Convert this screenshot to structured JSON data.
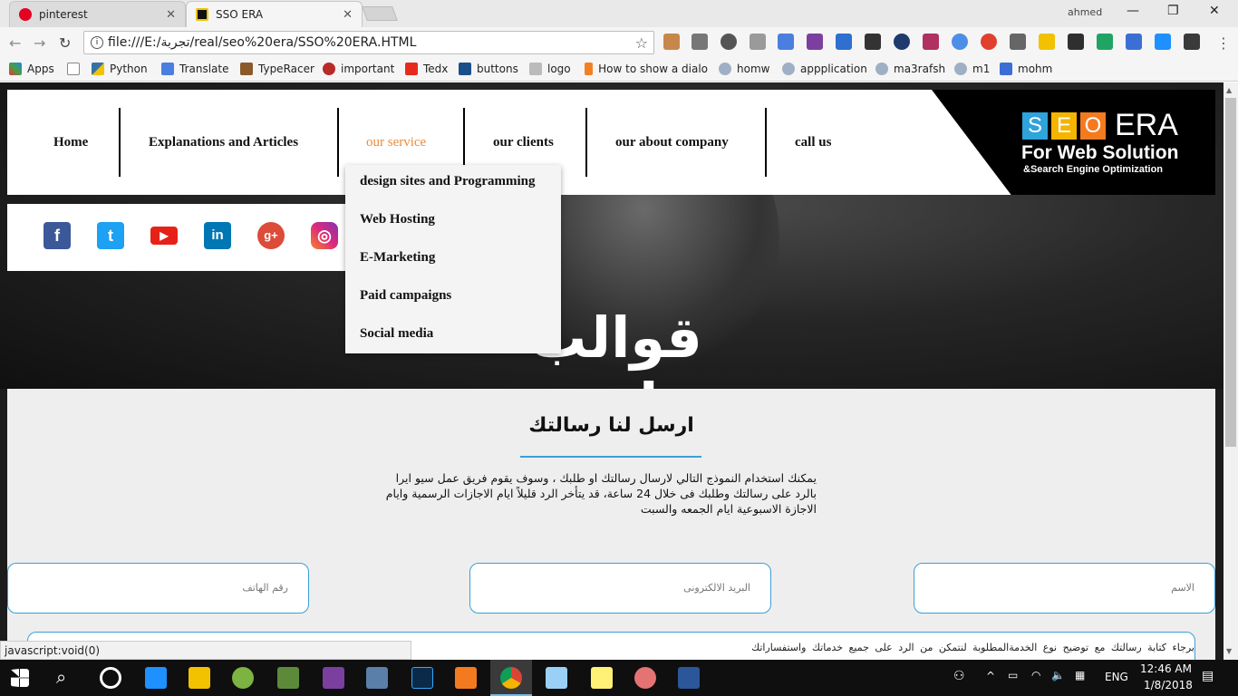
{
  "browser": {
    "tabs": [
      {
        "label": "pinterest",
        "icon": "pinterest-icon",
        "color": "#e60023"
      },
      {
        "label": "SSO ERA",
        "icon": "sso-era-favicon",
        "color": "#f2c200"
      }
    ],
    "user": "ahmed",
    "url": "file:///E:/تجربة/real/seo%20era/SSO%20ERA.HTML",
    "bookmarks": [
      {
        "label": "Apps",
        "icon": "apps-grid-icon"
      },
      {
        "label": "",
        "icon": "page-icon"
      },
      {
        "label": "Python",
        "icon": "python-icon"
      },
      {
        "label": "Translate",
        "icon": "translate-icon"
      },
      {
        "label": "TypeRacer",
        "icon": "typeracer-icon"
      },
      {
        "label": "important",
        "icon": "quora-icon"
      },
      {
        "label": "Tedx",
        "icon": "tedx-icon"
      },
      {
        "label": "buttons",
        "icon": "buttons-icon"
      },
      {
        "label": "logo",
        "icon": "logo-dots-icon"
      },
      {
        "label": "How to show a dialo",
        "icon": "stack-icon"
      },
      {
        "label": "homw",
        "icon": "uwc-icon"
      },
      {
        "label": "appplication",
        "icon": "uwc-icon"
      },
      {
        "label": "ma3rafsh",
        "icon": "uwc-icon"
      },
      {
        "label": "m1",
        "icon": "uwc-icon"
      },
      {
        "label": "mohm",
        "icon": "doc-icon"
      }
    ]
  },
  "site": {
    "nav": [
      {
        "label": "Home",
        "active": false
      },
      {
        "label": "Explanations and Articles",
        "active": false
      },
      {
        "label": "our service",
        "active": true
      },
      {
        "label": "our clients",
        "active": false
      },
      {
        "label": "our about company",
        "active": false
      },
      {
        "label": "call us",
        "active": false
      }
    ],
    "dropdown": [
      "design sites and Programming",
      "Web Hosting",
      "E-Marketing",
      "Paid campaigns",
      "Social media"
    ],
    "logo": {
      "letters": [
        "S",
        "E",
        "O"
      ],
      "letter_colors": [
        "#2ea3dc",
        "#f4b400",
        "#f47a20"
      ],
      "brand": "ERA",
      "tagline": "For Web Solution",
      "subtagline": "&Search Engine Optimization"
    },
    "social": [
      {
        "icon": "facebook-icon",
        "glyph": "f",
        "color": "#3b5998"
      },
      {
        "icon": "twitter-icon",
        "glyph": "t",
        "color": "#1da1f2"
      },
      {
        "icon": "youtube-icon",
        "glyph": "▶",
        "color": "#e62117"
      },
      {
        "icon": "linkedin-icon",
        "glyph": "in",
        "color": "#0077b5"
      },
      {
        "icon": "googleplus-icon",
        "glyph": "g+",
        "color": "#dd4b39"
      },
      {
        "icon": "instagram-icon",
        "glyph": "◎",
        "color": "#c13584"
      }
    ],
    "hero_title": "قوالب جاهزة",
    "contact": {
      "title": "ارسل لنا رسالتك",
      "description": "يمكنك استخدام النموذج التالي لارسال رسالتك او طلبك ، وسوف يقوم فريق عمل سيو ايرا بالرد على رسالتك وطلبك فى خلال 24 ساعة، قد يتأخر الرد قليلاً ايام الاجازات الرسمية وايام الاجازة الاسبوعية ايام الجمعه والسبت",
      "name_placeholder": "الاسم",
      "email_placeholder": "البريد الالكترونى",
      "phone_placeholder": "رقم الهاتف",
      "message_placeholder": "برجاء كتابة رسالتك مع توضيح نوع الخدمةالمطلوبة لنتمكن من الرد على جميع خدماتك واستفساراتك"
    },
    "accent_color": "#3aa0d8",
    "active_nav_color": "#e98b3a"
  },
  "statusbar": "javascript:void(0)",
  "taskbar": {
    "time": "12:46 AM",
    "date": "1/8/2018",
    "lang": "ENG"
  }
}
